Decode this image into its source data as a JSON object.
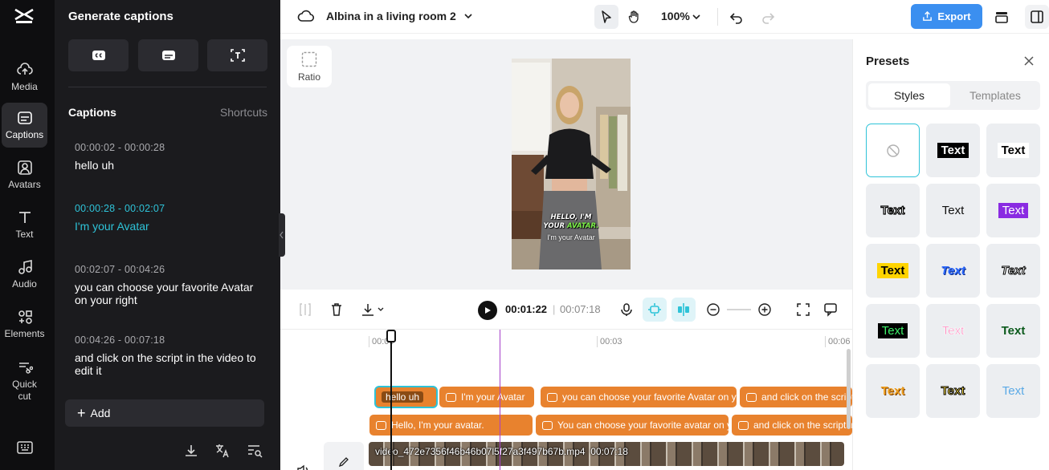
{
  "app": {
    "logo": "capcut-logo-icon"
  },
  "rail": {
    "items": [
      {
        "label": "Media",
        "icon": "upload-cloud-icon"
      },
      {
        "label": "Captions",
        "icon": "captions-icon"
      },
      {
        "label": "Avatars",
        "icon": "avatar-icon"
      },
      {
        "label": "Text",
        "icon": "text-icon"
      },
      {
        "label": "Audio",
        "icon": "music-note-icon"
      },
      {
        "label": "Elements",
        "icon": "elements-icon"
      },
      {
        "label": "Quick cut",
        "icon": "scissors-icon"
      }
    ],
    "bottom_icon": "keyboard-icon"
  },
  "panel": {
    "title": "Generate captions",
    "section_title": "Captions",
    "shortcuts": "Shortcuts",
    "captions": [
      {
        "time": "00:00:02 - 00:00:28",
        "text": "hello uh"
      },
      {
        "time": "00:00:28 - 00:02:07",
        "text": "I'm your Avatar"
      },
      {
        "time": "00:02:07 - 00:04:26",
        "text": "you can choose your favorite Avatar on your right"
      },
      {
        "time": "00:04:26 - 00:07:18",
        "text": "and click on the script in the video to edit it"
      }
    ],
    "add_label": "Add"
  },
  "topbar": {
    "project_title": "Albina in a living room 2",
    "zoom": "100%",
    "export_label": "Export"
  },
  "canvas": {
    "ratio_label": "Ratio",
    "video_caption_line1": "HELLO, I'M",
    "video_caption_line2a": "YOUR ",
    "video_caption_line2b": "AVATAR.",
    "video_subtitle": "I'm your Avatar"
  },
  "timeline": {
    "current_time": "00:01:22",
    "separator": "|",
    "total_time": "00:07:18",
    "ruler": [
      "00:00",
      "00:03",
      "00:06"
    ],
    "caption_track": [
      {
        "text": "hello uh"
      },
      {
        "text": "I'm your Avatar"
      },
      {
        "text": "you can choose your favorite Avatar on your right"
      },
      {
        "text": "and click on the script in the video to edit it"
      }
    ],
    "text_track": [
      {
        "text": "Hello, I'm your avatar."
      },
      {
        "text": "You can choose your favorite avatar on your right"
      },
      {
        "text": "and click on the script in the video to edit it"
      }
    ],
    "video_track_label": "video_472e7356f46b46b07l5f27a3f497b67b.mp4",
    "video_track_duration": "00:07:18"
  },
  "presets": {
    "title": "Presets",
    "tabs": [
      "Styles",
      "Templates"
    ],
    "tile_text": "Text",
    "colors": {
      "accent": "#2ec3d8",
      "export": "#3b8ff0",
      "clip": "#e8822e",
      "marker": "#a640c9"
    }
  }
}
